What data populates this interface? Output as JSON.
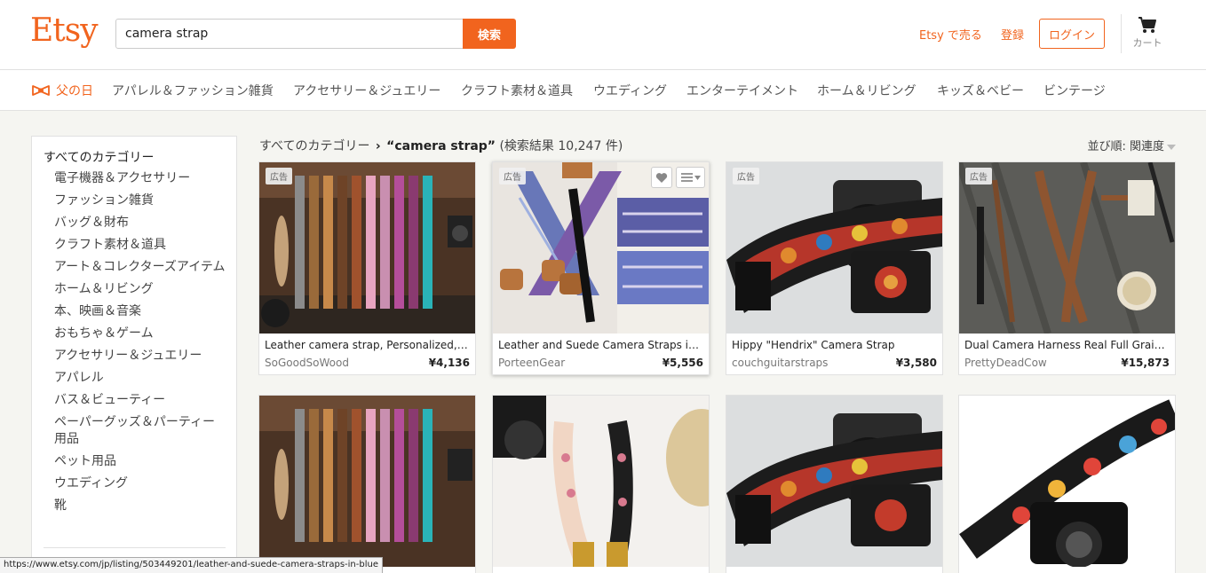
{
  "header": {
    "logo": "Etsy",
    "search_value": "camera strap",
    "search_button": "検索",
    "sell_link": "Etsy で売る",
    "register_link": "登録",
    "login_button": "ログイン",
    "cart_label": "カート"
  },
  "category_nav": [
    "父の日",
    "アパレル＆ファッション雑貨",
    "アクセサリー＆ジュエリー",
    "クラフト素材＆道具",
    "ウエディング",
    "エンターテイメント",
    "ホーム＆リビング",
    "キッズ＆ベビー",
    "ビンテージ"
  ],
  "sidebar": {
    "all_label": "すべてのカテゴリー",
    "items": [
      "電子機器＆アクセサリー",
      "ファッション雑貨",
      "バッグ＆財布",
      "クラフト素材＆道具",
      "アート＆コレクターズアイテム",
      "ホーム＆リビング",
      "本、映画＆音楽",
      "おもちゃ＆ゲーム",
      "アクセサリー＆ジュエリー",
      "アパレル",
      "バス＆ビューティー",
      "ペーパーグッズ＆パーティー用品",
      "ペット用品",
      "ウエディング",
      "靴"
    ]
  },
  "breadcrumb": {
    "root": "すべてのカテゴリー",
    "query": "“camera strap”",
    "result_count": "(検索結果 10,247 件)"
  },
  "sort": {
    "label": "並び順:",
    "value": "関連度"
  },
  "ad_label": "広告",
  "products_row1": [
    {
      "title": "Leather camera strap, Personalized, gift for photographer",
      "shop": "SoGoodSoWood",
      "price": "¥4,136",
      "ad": true
    },
    {
      "title": "Leather and Suede Camera Straps in Blue",
      "shop": "PorteenGear",
      "price": "¥5,556",
      "ad": true
    },
    {
      "title": "Hippy \"Hendrix\" Camera Strap",
      "shop": "couchguitarstraps",
      "price": "¥3,580",
      "ad": true
    },
    {
      "title": "Dual Camera Harness Real Full Grain Leather",
      "shop": "PrettyDeadCow",
      "price": "¥15,873",
      "ad": true
    }
  ],
  "status_url": "https://www.etsy.com/jp/listing/503449201/leather-and-suede-camera-straps-in-blue",
  "colors": {
    "accent": "#f1641e"
  }
}
